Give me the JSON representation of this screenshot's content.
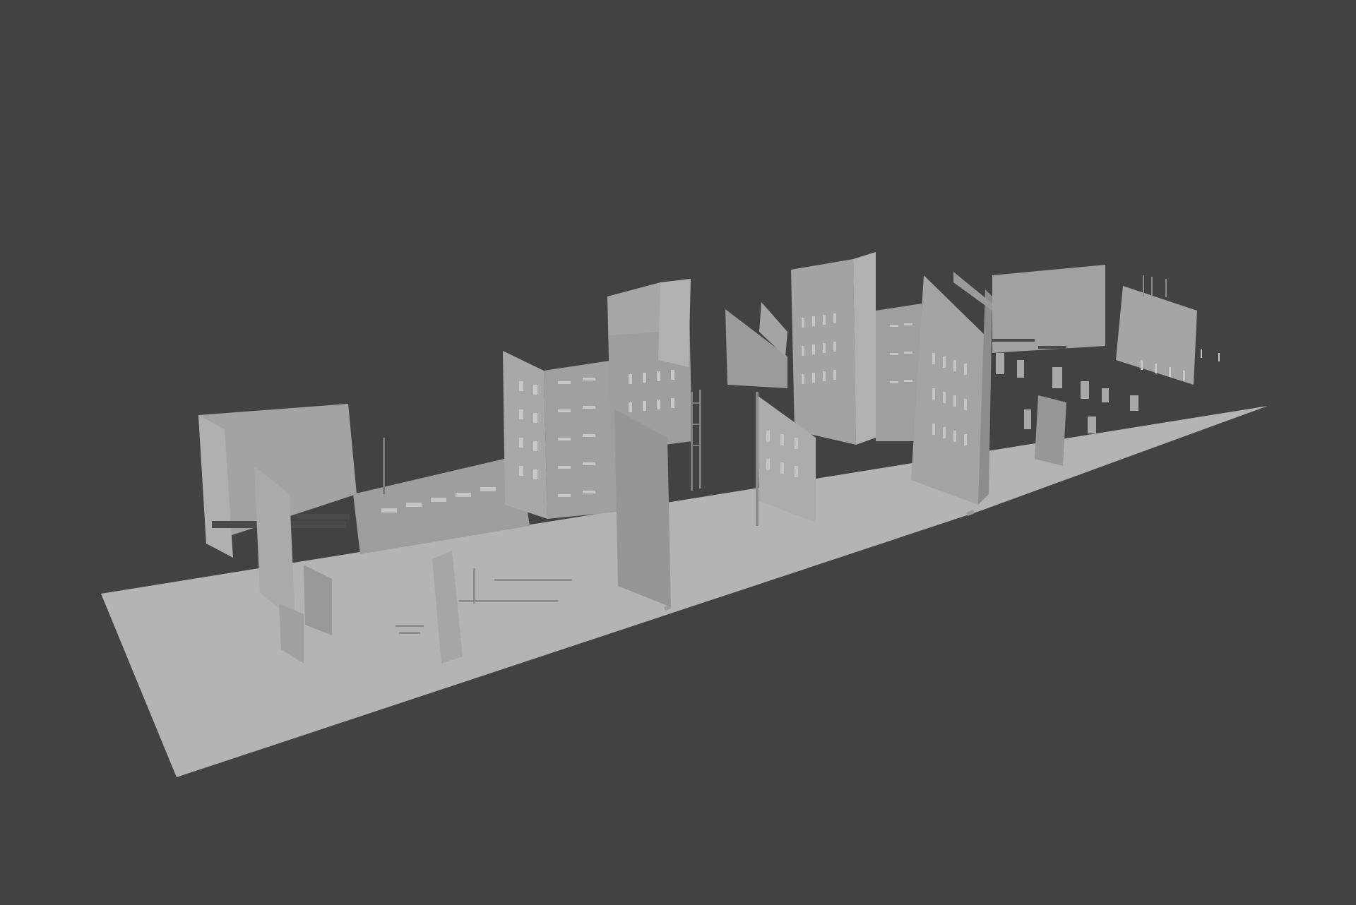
{
  "viewport": {
    "background_color": "#424242",
    "ground_color": "#b4b4b4",
    "facade_color": "#a3a3a3",
    "facade_light_color": "#b0b0b0",
    "facade_dark_color": "#8c8c8c",
    "opening_color": "#c9c9c9",
    "shadow_color": "#4a4a4a"
  }
}
